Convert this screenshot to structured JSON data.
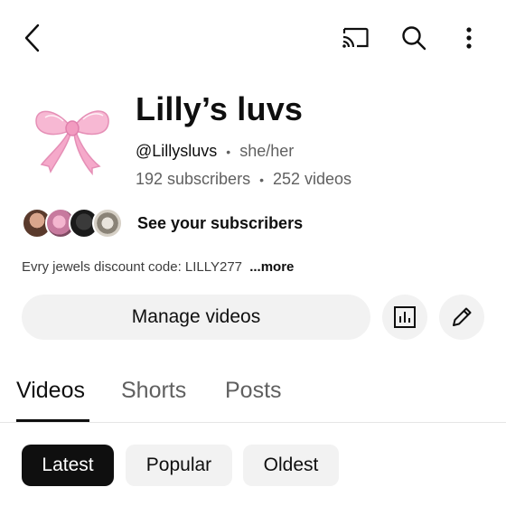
{
  "colors": {
    "text_primary": "#0f0f0f",
    "text_secondary": "#606060",
    "chip_bg": "#f2f2f2",
    "chip_selected_bg": "#0f0f0f"
  },
  "top_bar": {
    "icons": [
      "back-icon",
      "cast-icon",
      "search-icon",
      "more-vert-icon"
    ]
  },
  "channel": {
    "title": "Lilly’s luvs",
    "handle": "@Lillysluvs",
    "pronouns": "she/her",
    "subscribers": "192 subscribers",
    "videos": "252 videos",
    "separator": "•"
  },
  "subscribers_link": {
    "label": "See your subscribers"
  },
  "description": {
    "text": "Evry jewels discount code: LILLY277",
    "more": "...more"
  },
  "actions": {
    "manage_videos": "Manage videos",
    "icons": [
      "analytics-icon",
      "edit-icon"
    ]
  },
  "tabs": [
    {
      "label": "Videos",
      "active": true
    },
    {
      "label": "Shorts",
      "active": false
    },
    {
      "label": "Posts",
      "active": false
    }
  ],
  "sort_chips": [
    {
      "label": "Latest",
      "selected": true
    },
    {
      "label": "Popular",
      "selected": false
    },
    {
      "label": "Oldest",
      "selected": false
    }
  ]
}
